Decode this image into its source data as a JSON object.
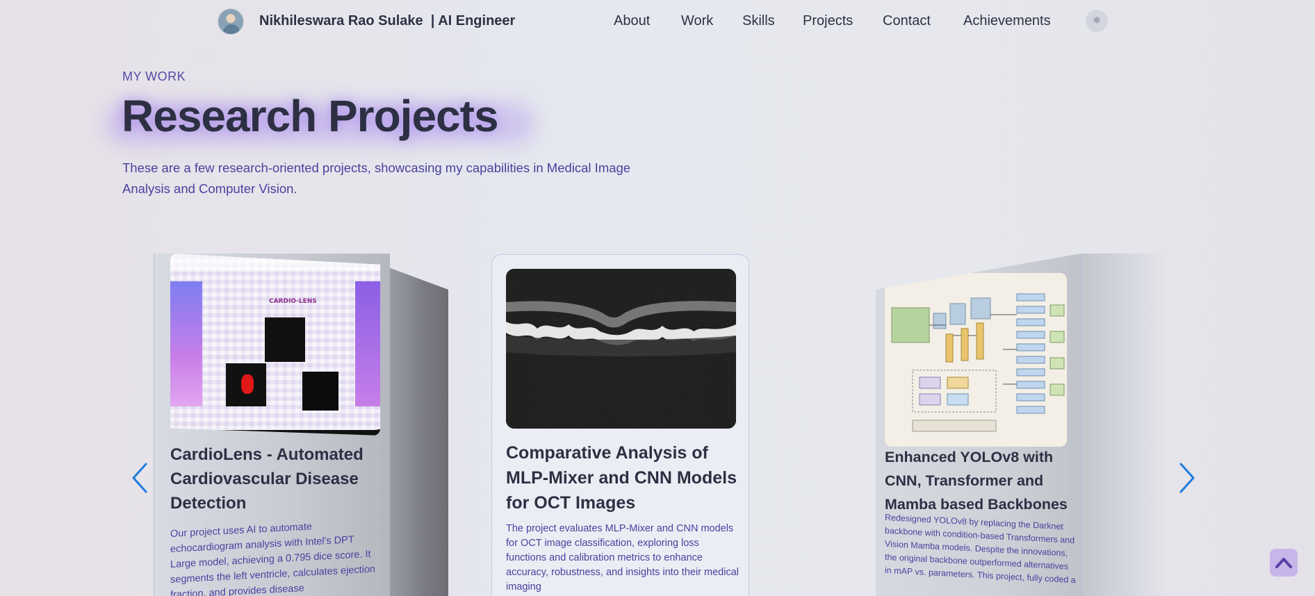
{
  "nav": {
    "brand": "Nikhileswara Rao Sulake  | AI Engineer",
    "links": [
      "About",
      "Work",
      "Skills",
      "Projects",
      "Contact",
      "Achievements"
    ],
    "theme_icon": "☼"
  },
  "section": {
    "eyebrow": "MY WORK",
    "title": "Research Projects",
    "intro": "These are a few research-oriented projects, showcasing my capabilities in Medical Image Analysis and Computer Vision."
  },
  "cards": [
    {
      "title": "CardioLens - Automated Cardiovascular Disease Detection",
      "description": "Our project uses AI to automate echocardiogram analysis with Intel's DPT Large model, achieving a 0.795 dice score. It segments the left ventricle, calculates ejection fraction, and provides disease",
      "image_text": "CARDIO-LENS"
    },
    {
      "title": "Comparative Analysis of MLP-Mixer and CNN Models for OCT Images",
      "description": "The project evaluates MLP-Mixer and CNN models for OCT image classification, exploring loss functions and calibration metrics to enhance accuracy, robustness, and insights into their medical imaging"
    },
    {
      "title": "Enhanced YOLOv8 with CNN, Transformer and Mamba based Backbones",
      "description": "Redesigned YOLOv8 by replacing the Darknet backbone with condition-based Transformers and Vision Mamba models. Despite the innovations, the original backbone outperformed alternatives in mAP vs. parameters. This project, fully coded a"
    }
  ],
  "controls": {
    "prev_icon": "chevron-left-icon",
    "next_icon": "chevron-right-icon",
    "top_icon": "chevron-up-icon"
  },
  "colors": {
    "accent": "#5849a8",
    "heading": "#2d3043",
    "arrow": "#1f7ae0"
  }
}
